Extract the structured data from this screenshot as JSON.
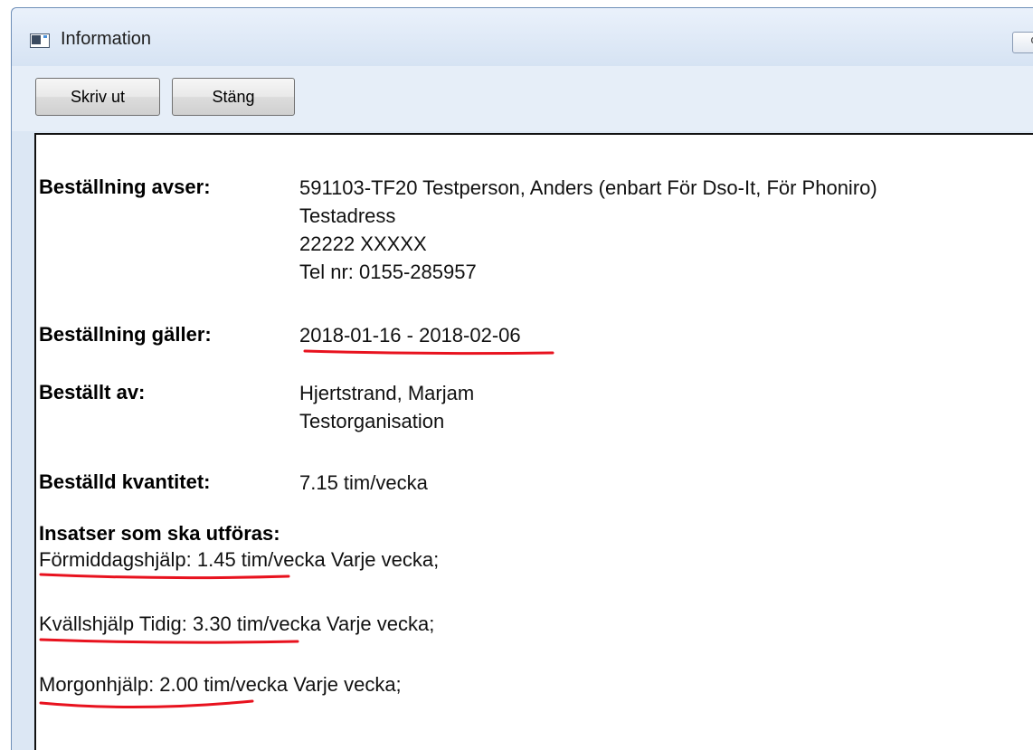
{
  "window": {
    "title": "Information",
    "icon": "app-window-icon",
    "control_partial": "c"
  },
  "toolbar": {
    "print_label": "Skriv ut",
    "close_label": "Stäng"
  },
  "order": {
    "regarding_label": "Beställning avser:",
    "regarding_lines": [
      "591103-TF20   Testperson, Anders  (enbart För Dso-It, För Phoniro)",
      "Testadress",
      "22222  XXXXX",
      "Tel nr: 0155-285957"
    ],
    "period_label": "Beställning gäller:",
    "period_value": "2018-01-16 - 2018-02-06",
    "ordered_by_label": "Beställt av:",
    "ordered_by_lines": [
      "Hjertstrand, Marjam",
      "Testorganisation"
    ],
    "quantity_label": "Beställd kvantitet:",
    "quantity_value": "7.15 tim/vecka",
    "tasks_heading": "Insatser som ska utföras:",
    "tasks": [
      "Förmiddagshjälp:  1.45 tim/vecka Varje vecka;",
      "Kvällshjälp Tidig:  3.30 tim/vecka Varje vecka;",
      "Morgonhjälp:  2.00 tim/vecka Varje vecka;"
    ]
  },
  "annotation_color": "#e8121e"
}
